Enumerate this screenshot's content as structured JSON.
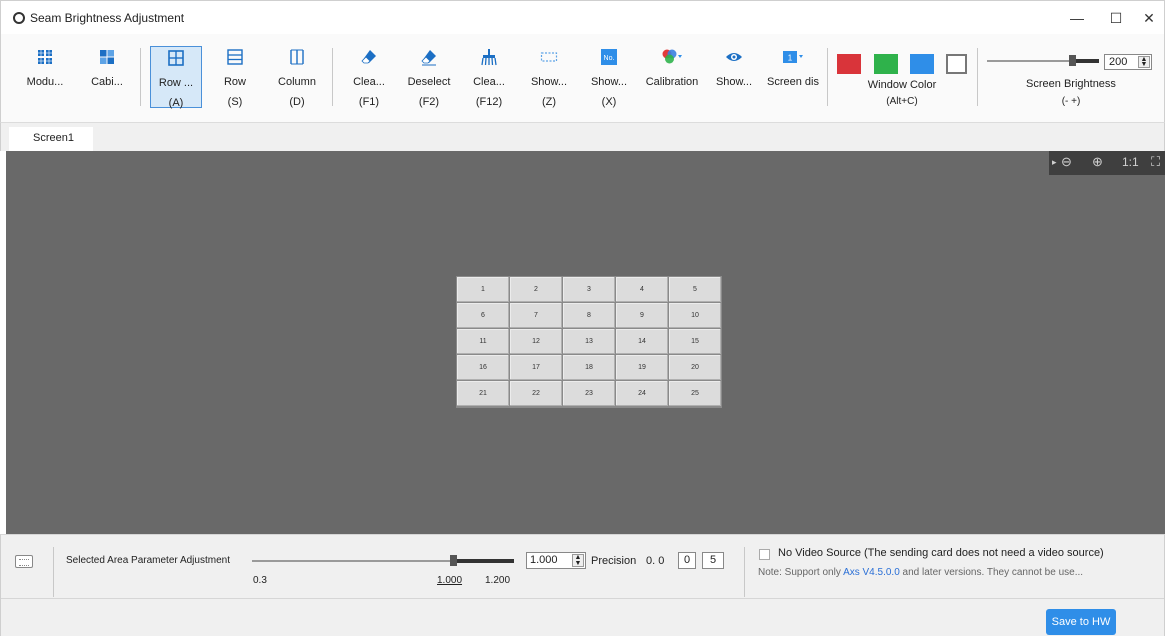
{
  "window": {
    "title": "Seam Brightness Adjustment",
    "minimize": "—",
    "maximize": "☐",
    "close": "✕"
  },
  "toolbar": {
    "tools": [
      {
        "label": "Modu...",
        "sub": "",
        "icon": "module-icon"
      },
      {
        "label": "Cabi...",
        "sub": "",
        "icon": "cabinet-icon"
      },
      {
        "label": "Row ...",
        "sub": "(A)",
        "icon": "row-column-grid-icon",
        "active": true
      },
      {
        "label": "Row",
        "sub": "(S)",
        "icon": "row-icon"
      },
      {
        "label": "Column",
        "sub": "(D)",
        "icon": "column-icon"
      },
      {
        "label": "Clea...",
        "sub": "(F1)",
        "icon": "eraser-icon"
      },
      {
        "label": "Deselect",
        "sub": "(F2)",
        "icon": "deselect-eraser-icon"
      },
      {
        "label": "Clea...",
        "sub": "(F12)",
        "icon": "broom-icon"
      },
      {
        "label": "Show...",
        "sub": "(Z)",
        "icon": "dashed-rect-icon"
      },
      {
        "label": "Show...",
        "sub": "(X)",
        "icon": "number-icon"
      },
      {
        "label": "Calibration",
        "sub": "",
        "icon": "rgb-circles-icon"
      },
      {
        "label": "Show...",
        "sub": "",
        "icon": "eye-icon"
      },
      {
        "label": "Screen dis",
        "sub": "",
        "icon": "screen-number-icon"
      }
    ],
    "number_icon_text": "No.",
    "screen_icon_text": "1",
    "window_color": {
      "label": "Window Color",
      "shortcut": "(Alt+C)",
      "swatches": [
        "#d9343a",
        "#2fb24b",
        "#2f8ee8",
        "#ffffff"
      ]
    },
    "brightness": {
      "label": "Screen Brightness",
      "shortcut": "(-  +)",
      "value": "200",
      "level": 0.78
    }
  },
  "tabs": [
    "Screen1"
  ],
  "canvas": {
    "zoom_controls": {
      "expand": "▸",
      "zoom_out": "⊖",
      "zoom_in": "⊕",
      "actual": "1:1",
      "fit": "⛶"
    },
    "cells": [
      "1",
      "2",
      "3",
      "4",
      "5",
      "6",
      "7",
      "8",
      "9",
      "10",
      "11",
      "12",
      "13",
      "14",
      "15",
      "16",
      "17",
      "18",
      "19",
      "20",
      "21",
      "22",
      "23",
      "24",
      "25"
    ]
  },
  "bottom": {
    "param_label": "Selected Area Parameter Adjustment",
    "slider_min": "0.3",
    "slider_current": "1.000",
    "slider_max": "1.200",
    "value": "1.000",
    "precision_label": "Precision",
    "precision_int": "0. 0",
    "precision_d1": "0",
    "precision_d2": "5",
    "no_video_source": "No Video Source (The sending card does not need a video source)",
    "note_prefix": "Note: Support only ",
    "note_link": "Axs V4.5.0.0",
    "note_suffix": " and later versions. They cannot be use...",
    "save_button": "Save to HW"
  },
  "colors": {
    "accent": "#2f8ee8",
    "canvas": "#696969",
    "active_tool": "#d6e8f8"
  }
}
